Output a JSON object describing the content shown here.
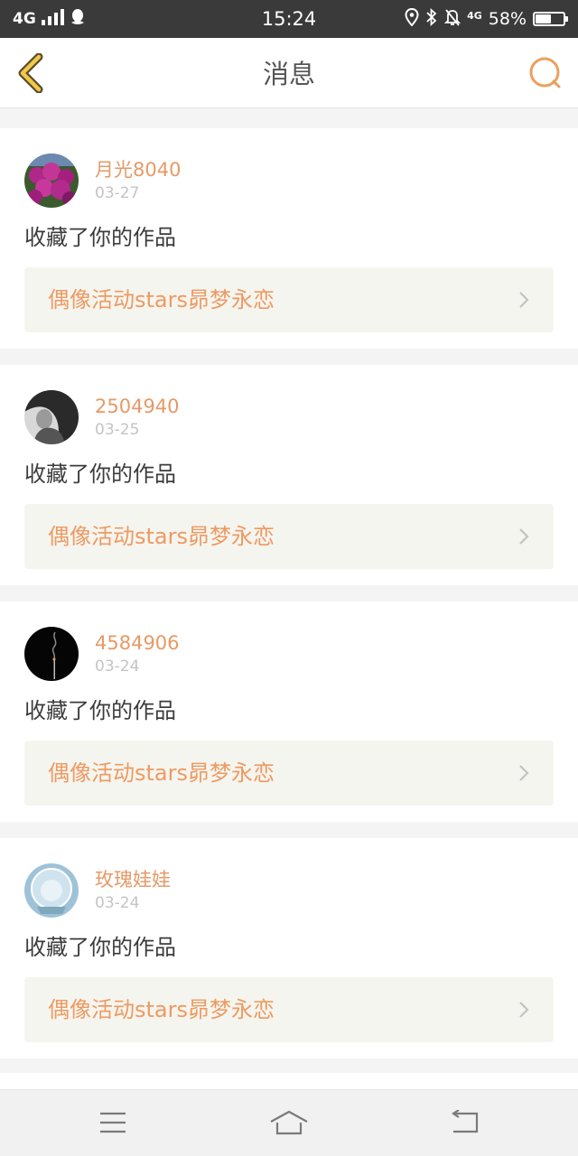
{
  "status_bar": {
    "network": "4G",
    "time": "15:24",
    "network_small": "4G",
    "battery_percent": "58%",
    "battery_level": 0.58
  },
  "header": {
    "title": "消息",
    "accent_color": "#e9a15f"
  },
  "messages": [
    {
      "username": "月光8040",
      "date": "03-27",
      "action": "收藏了你的作品",
      "work_title": "偶像活动stars昴梦永恋"
    },
    {
      "username": "2504940",
      "date": "03-25",
      "action": "收藏了你的作品",
      "work_title": "偶像活动stars昴梦永恋"
    },
    {
      "username": "4584906",
      "date": "03-24",
      "action": "收藏了你的作品",
      "work_title": "偶像活动stars昴梦永恋"
    },
    {
      "username": "玫瑰娃娃",
      "date": "03-24",
      "action": "收藏了你的作品",
      "work_title": "偶像活动stars昴梦永恋"
    }
  ],
  "colors": {
    "username": "#e69a66",
    "work_title": "#ee9a62",
    "work_link_bg": "#f5f5ef"
  }
}
